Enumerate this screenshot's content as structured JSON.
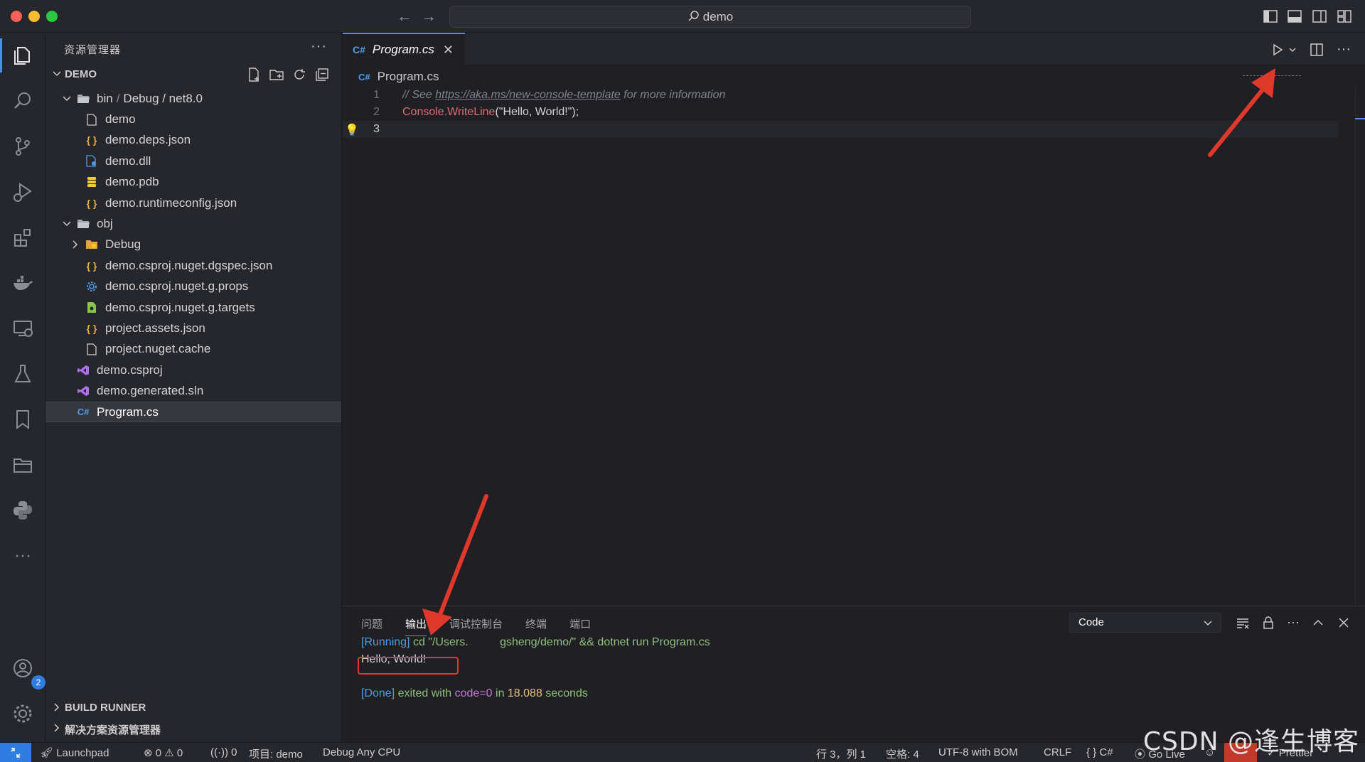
{
  "titlebar": {
    "search_text": "demo"
  },
  "activity_bar": {
    "items": [
      "explorer",
      "search",
      "source-control",
      "run-debug",
      "extensions",
      "docker",
      "remote-explorer",
      "testing",
      "bookmarks",
      "project-manager",
      "python",
      "more"
    ],
    "accounts_badge": "2"
  },
  "sidebar": {
    "title": "资源管理器",
    "more": "···",
    "section": "DEMO",
    "tree": [
      {
        "label": "bin",
        "path_rest": "Debug / net8.0",
        "depth": 1,
        "kind": "folder-open"
      },
      {
        "label": "demo",
        "depth": 2,
        "kind": "file"
      },
      {
        "label": "demo.deps.json",
        "depth": 2,
        "kind": "json"
      },
      {
        "label": "demo.dll",
        "depth": 2,
        "kind": "dll"
      },
      {
        "label": "demo.pdb",
        "depth": 2,
        "kind": "pdb"
      },
      {
        "label": "demo.runtimeconfig.json",
        "depth": 2,
        "kind": "json"
      },
      {
        "label": "obj",
        "depth": 1,
        "kind": "folder-open"
      },
      {
        "label": "Debug",
        "depth": 2,
        "kind": "folder-closed"
      },
      {
        "label": "demo.csproj.nuget.dgspec.json",
        "depth": 2,
        "kind": "json"
      },
      {
        "label": "demo.csproj.nuget.g.props",
        "depth": 2,
        "kind": "props"
      },
      {
        "label": "demo.csproj.nuget.g.targets",
        "depth": 2,
        "kind": "targets"
      },
      {
        "label": "project.assets.json",
        "depth": 2,
        "kind": "json"
      },
      {
        "label": "project.nuget.cache",
        "depth": 2,
        "kind": "file"
      },
      {
        "label": "demo.csproj",
        "depth": 1,
        "kind": "vs"
      },
      {
        "label": "demo.generated.sln",
        "depth": 1,
        "kind": "vs"
      },
      {
        "label": "Program.cs",
        "depth": 1,
        "kind": "cs",
        "selected": true
      }
    ],
    "bottom_sections": [
      "BUILD RUNNER",
      "解决方案资源管理器"
    ]
  },
  "editor": {
    "tab_label": "Program.cs",
    "breadcrumb": "Program.cs",
    "lines": [
      {
        "n": "1",
        "comment_pre": "// See ",
        "link": "https://aka.ms/new-console-template",
        "comment_post": " for more information"
      },
      {
        "n": "2",
        "fn": "Console.WriteLine",
        "args": "(\"Hello, World!\");"
      },
      {
        "n": "3"
      }
    ]
  },
  "panel": {
    "tabs": [
      "问题",
      "输出",
      "调试控制台",
      "终端",
      "端口"
    ],
    "active_tab": "输出",
    "channel": "Code",
    "output": {
      "running_tag": "[Running]",
      "running_cmd": " cd \"/Users.          gsheng/demo/\" && dotnet run Program.cs",
      "hello": "Hello, World!",
      "done_tag": "[Done]",
      "done_pre": " exited with ",
      "done_code": "code=0",
      "done_mid": " in ",
      "done_secs": "18.088",
      "done_post": " seconds"
    }
  },
  "statusbar": {
    "launchpad": "Launchpad",
    "errors": "0",
    "warnings": "0",
    "ports": "0",
    "project": "项目: demo",
    "config": "Debug Any CPU",
    "position": "行 3，列 1",
    "spaces": "空格: 4",
    "encoding": "UTF-8 with BOM",
    "eol": "CRLF",
    "language": "C#",
    "golive": "Go Live",
    "prettier": "Prettier"
  },
  "watermark": "CSDN @逢生博客",
  "colors": {
    "accent": "#4d8ff0",
    "annotation_red": "#e0392b"
  }
}
